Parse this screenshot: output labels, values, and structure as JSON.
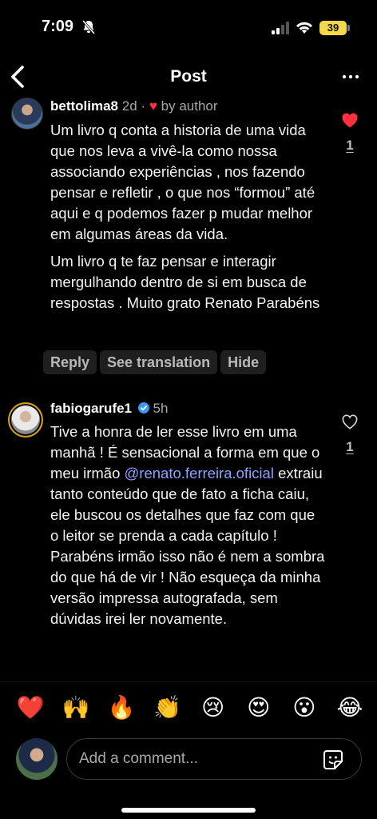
{
  "status_bar": {
    "time": "7:09",
    "battery": "39"
  },
  "nav": {
    "title": "Post"
  },
  "comments": [
    {
      "username": "bettolima8",
      "age": "2d",
      "separator": "·",
      "liked_by": "by author",
      "paragraphs": [
        "Um livro q conta a historia de uma vida que nos leva a vivê-la como nossa associando experiências , nos fazendo pensar e refletir , o que nos “formou” até aqui e q podemos fazer p mudar melhor em algumas áreas da vida.",
        "Um livro q te faz pensar e interagir mergulhando dentro de si em busca de respostas . Muito grato Renato Parabéns"
      ],
      "likes": "1",
      "liked": true,
      "actions": [
        "Reply",
        "See translation",
        "Hide"
      ]
    },
    {
      "username": "fabiogarufe1",
      "verified": true,
      "age": "5h",
      "text_before": "Tive a honra de ler esse livro em uma manhã ! É sensacional a forma em que o meu irmão ",
      "mention": "@renato.ferreira.oficial",
      "text_after": "  extraiu tanto conteúdo que de fato a ficha caiu, ele buscou os detalhes que faz com que o leitor se prenda a cada capítulo ! Parabéns irmão isso não é nem a sombra do que há de vir ! Não esqueça da minha versão impressa autografada, sem dúvidas irei ler novamente.",
      "likes": "1",
      "liked": false
    }
  ],
  "reactions": [
    "❤️",
    "🙌",
    "🔥",
    "👏",
    "😢",
    "😍",
    "😮",
    "😂"
  ],
  "composer": {
    "placeholder": "Add a comment..."
  },
  "colors": {
    "like_red": "#ff3040",
    "mention_blue": "#8ea1ff",
    "verified_blue": "#3897f0"
  }
}
